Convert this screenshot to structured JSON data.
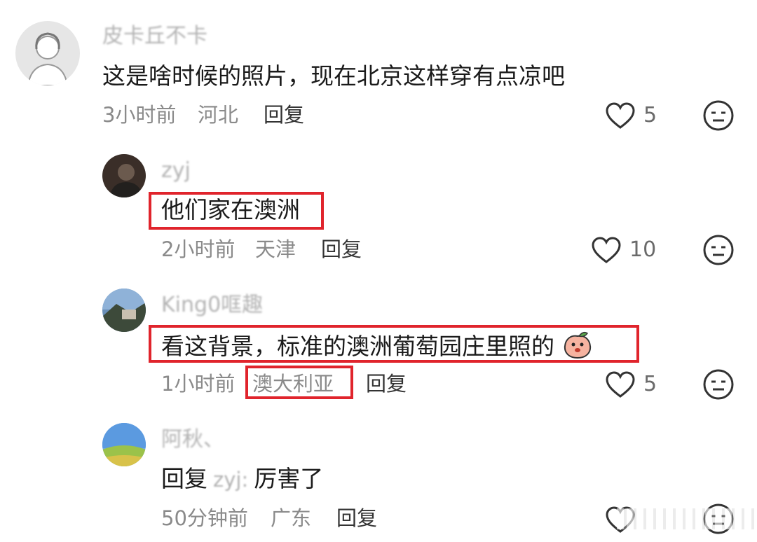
{
  "comments": [
    {
      "username": "皮卡丘不卡",
      "text": "这是啥时候的照片，现在北京这样穿有点凉吧",
      "time": "3小时前",
      "location": "河北",
      "reply_label": "回复",
      "likes": "5"
    },
    {
      "username": "zyj",
      "text": "他们家在澳洲",
      "time": "2小时前",
      "location": "天津",
      "reply_label": "回复",
      "likes": "10"
    },
    {
      "username": "King0哐趣",
      "text": "看这背景，标准的澳洲葡萄园庄里照的",
      "time": "1小时前",
      "location": "澳大利亚",
      "reply_label": "回复",
      "likes": "5"
    },
    {
      "username": "阿秋、",
      "reply_prefix": "回复",
      "reply_to": "zyj:",
      "text": "厉害了",
      "time": "50分钟前",
      "location": "广东",
      "reply_label": "回复",
      "likes": ""
    }
  ],
  "colors": {
    "highlight_box": "#e0242c",
    "meta_text": "#8a8a8a",
    "username": "#b3b3b3"
  },
  "icons": [
    "heart-icon",
    "dislike-face-icon",
    "peach-emoji-icon"
  ]
}
